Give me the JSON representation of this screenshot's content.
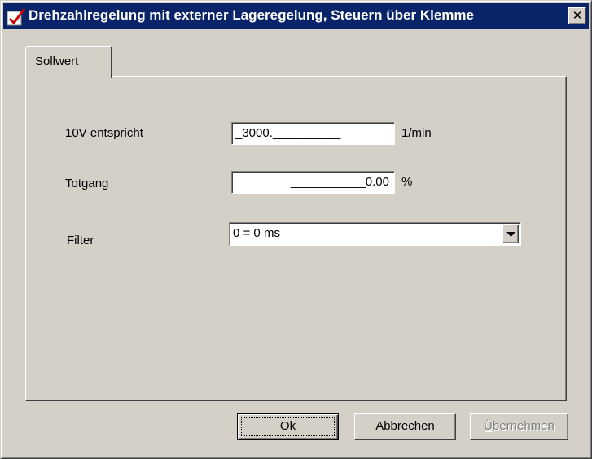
{
  "window": {
    "title": "Drehzahlregelung mit externer Lageregelung, Steuern über Klemme",
    "close_glyph": "✕"
  },
  "tabs": [
    {
      "label": "Sollwert",
      "selected": true
    }
  ],
  "form": {
    "volt_label": "10V entspricht",
    "volt_value": "_3000.__________",
    "volt_unit": "1/min",
    "deadband_label": "Totgang",
    "deadband_value": "___________0.00",
    "deadband_unit": "%",
    "filter_label": "Filter",
    "filter_value": "0 = 0 ms"
  },
  "buttons": {
    "ok_mnemonic": "O",
    "ok_rest": "k",
    "cancel_mnemonic": "A",
    "cancel_rest": "bbrechen",
    "apply_mnemonic": "Ü",
    "apply_rest": "bernehmen"
  },
  "icons": {
    "app": "app-icon-red-checkmark",
    "close": "close-icon",
    "dropdown": "dropdown-arrow-icon"
  }
}
